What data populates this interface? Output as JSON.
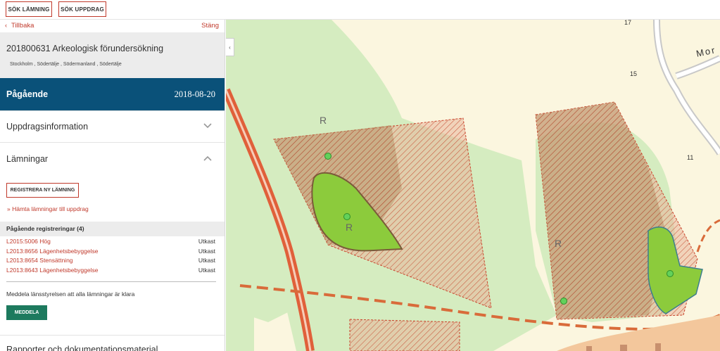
{
  "toolbar": {
    "search_lamning": "SÖK LÄMNING",
    "search_uppdrag": "SÖK UPPDRAG"
  },
  "panel": {
    "back_label": "Tillbaka",
    "close_label": "Stäng",
    "title": "201800631 Arkeologisk förundersökning",
    "subtitle": "Stockholm , Södertälje , Södermanland , Södertälje",
    "status": "Pågående",
    "status_date": "2018-08-20",
    "sections": {
      "info": "Uppdragsinformation",
      "lamningar": "Lämningar",
      "rapporter": "Rapporter och dokumentationsmaterial"
    },
    "register_button": "REGISTRERA NY LÄMNING",
    "fetch_link": "» Hämta lämningar till uppdrag",
    "registrations_header": "Pågående registreringar (4)",
    "registrations": [
      {
        "name": "L2015:5006 Hög",
        "status": "Utkast"
      },
      {
        "name": "L2013:8656 Lägenhetsbebyggelse",
        "status": "Utkast"
      },
      {
        "name": "L2013:8654 Stensättning",
        "status": "Utkast"
      },
      {
        "name": "L2013:8643 Lägenhetsbebyggelse",
        "status": "Utkast"
      }
    ],
    "notify_text": "Meddela länsstyrelsen att alla lämningar är klara",
    "notify_button": "MEDDELA"
  },
  "map": {
    "labels": [
      "17",
      "15",
      "11",
      "Mor"
    ],
    "colors": {
      "background": "#fbf6df",
      "green_area": "#d5ecc0",
      "hatch_red": "#d9593f",
      "polygon_green": "#8ccb3c",
      "road": "#e2623b"
    }
  }
}
